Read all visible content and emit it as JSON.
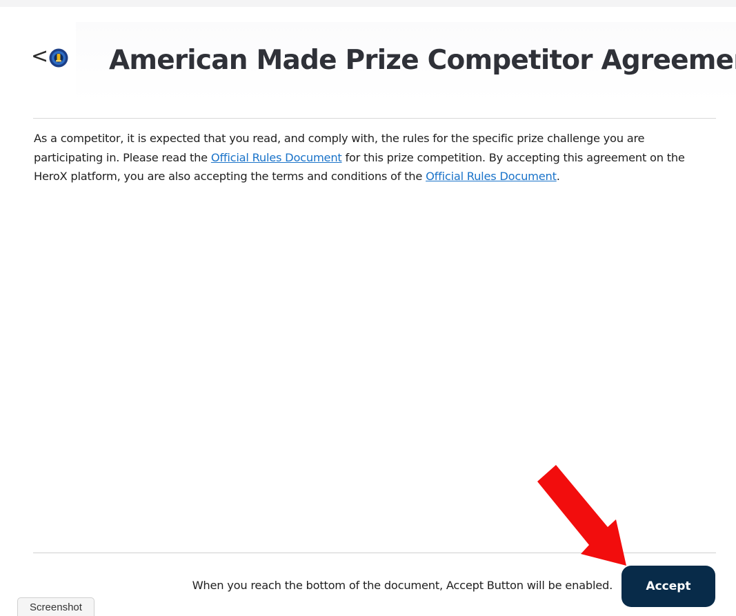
{
  "header": {
    "back_glyph": "<",
    "title": "American Made Prize Competitor Agreement"
  },
  "document": {
    "part1": "As a competitor, it is expected that you read, and comply with, the rules for the specific prize challenge you are participating in.  Please read the ",
    "link1": "Official Rules Document",
    "part2": " for this prize competition. By accepting this agreement on the HeroX platform, you are also accepting the terms and conditions of the ",
    "link2": "Official Rules Document",
    "part3": "."
  },
  "footer": {
    "note": "When you reach the bottom of the document, Accept Button will be enabled.",
    "accept_label": "Accept"
  },
  "overlay": {
    "tab_label": "Screenshot"
  },
  "colors": {
    "accent_button": "#082b49",
    "link": "#1a73c9",
    "annotation_arrow": "#f20d0d",
    "logo_ring": "#1d3f86",
    "logo_center": "#e8b21a"
  },
  "icons": {
    "back": "chevron-left-icon",
    "logo": "american-made-logo-icon",
    "annotation": "red-arrow-annotation"
  }
}
